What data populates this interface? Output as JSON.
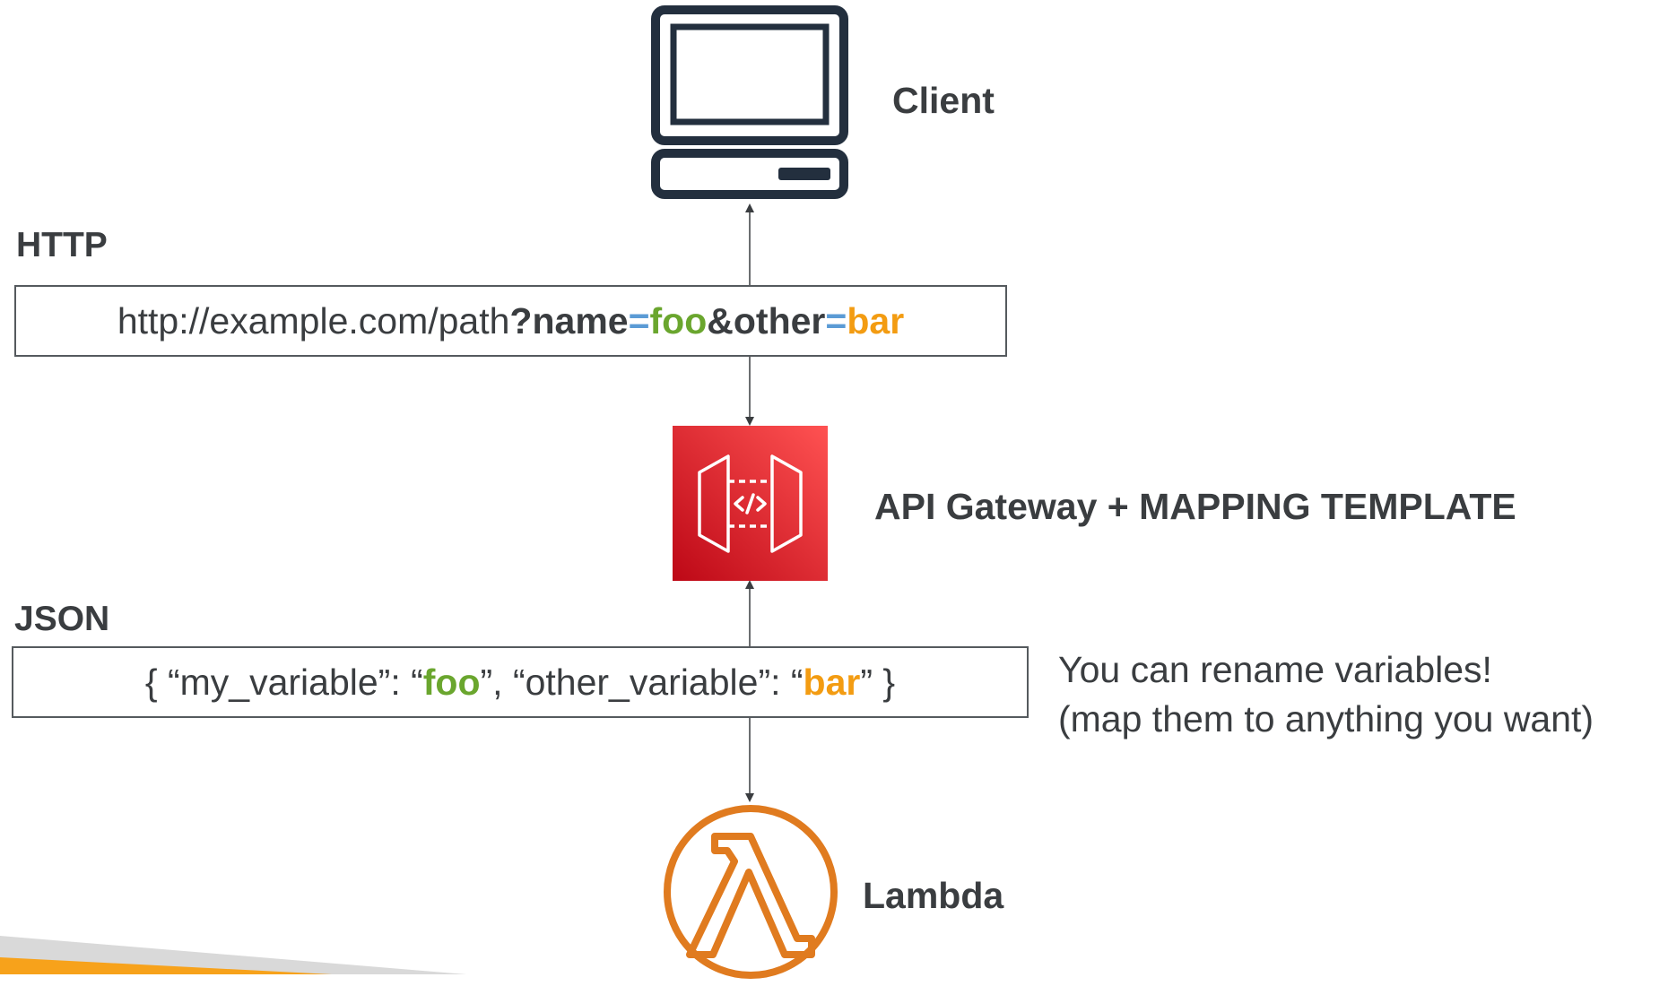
{
  "client": {
    "label": "Client",
    "icon": "desktop-computer-icon"
  },
  "http": {
    "label": "HTTP",
    "url_base": "http://example.com/path",
    "q_mark": "?",
    "param1_name": "name",
    "eq1": "=",
    "param1_value": "foo",
    "amp": "&",
    "param2_name": "other",
    "eq2": "=",
    "param2_value": "bar"
  },
  "gateway": {
    "label": "API Gateway + MAPPING TEMPLATE",
    "icon": "api-gateway-icon",
    "color": "#d6232f"
  },
  "json": {
    "label": "JSON",
    "open": "{ “my_variable”: “",
    "value1": "foo",
    "middle": "”, “other_variable”: “",
    "value2": "bar",
    "close": "” }"
  },
  "note": {
    "line1": "You can rename variables!",
    "line2": "(map them to anything you want)"
  },
  "lambda": {
    "label": "Lambda",
    "icon": "lambda-icon",
    "color": "#e07b1f"
  },
  "colors": {
    "text": "#3a3d40",
    "green": "#6aa62e",
    "blue": "#5b9bd5",
    "orange": "#f39c12",
    "footer_orange": "#f7a21b",
    "footer_grey": "#d9d9d9"
  }
}
